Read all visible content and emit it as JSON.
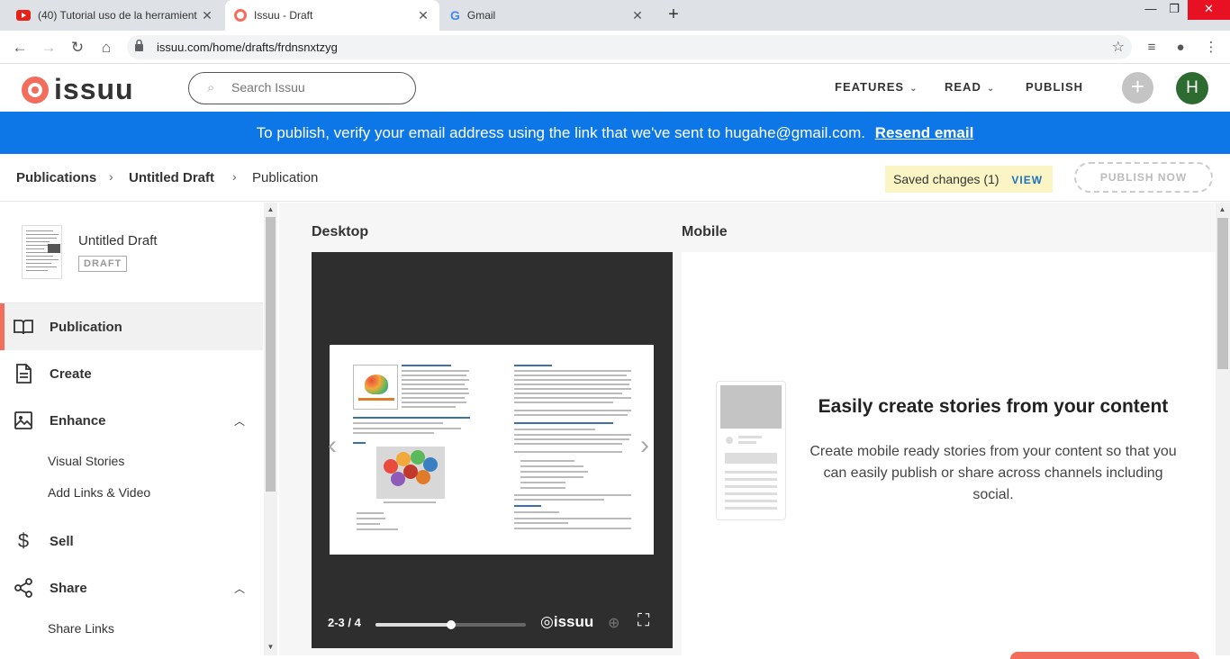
{
  "browser": {
    "tabs": [
      {
        "title": "(40) Tutorial uso de la herramient",
        "icon": "youtube-icon"
      },
      {
        "title": "Issuu - Draft",
        "icon": "issuu-icon"
      },
      {
        "title": "Gmail",
        "icon": "google-icon"
      }
    ],
    "new_tab": "+",
    "url": "issuu.com/home/drafts/frdnsnxtzyg"
  },
  "header": {
    "logo": "issuu",
    "search_placeholder": "Search Issuu",
    "nav": {
      "features": "FEATURES",
      "read": "READ",
      "publish": "PUBLISH"
    },
    "avatar_initial": "H"
  },
  "banner": {
    "text": "To publish, verify your email address using the link that we've sent to hugahe@gmail.com.",
    "link": "Resend email"
  },
  "breadcrumb": {
    "items": [
      "Publications",
      "Untitled Draft",
      "Publication"
    ]
  },
  "status": {
    "saved": "Saved changes (1)",
    "view": "VIEW",
    "publish_now": "PUBLISH NOW"
  },
  "sidebar": {
    "draft_title": "Untitled Draft",
    "draft_badge": "DRAFT",
    "items": [
      {
        "label": "Publication",
        "icon": "book-icon"
      },
      {
        "label": "Create",
        "icon": "document-icon"
      },
      {
        "label": "Enhance",
        "icon": "image-icon"
      },
      {
        "label": "Sell",
        "icon": "dollar-icon"
      },
      {
        "label": "Share",
        "icon": "share-icon"
      }
    ],
    "enhance_sub": [
      "Visual Stories",
      "Add Links & Video"
    ],
    "share_sub": [
      "Share Links"
    ]
  },
  "main": {
    "desktop_label": "Desktop",
    "mobile_label": "Mobile",
    "viewer": {
      "page": "2-3 / 4",
      "brand": "issuu",
      "progress": 0.5
    },
    "stories": {
      "title": "Easily create stories from your content",
      "description": "Create mobile ready stories from your content so that you can easily publish or share across channels including social."
    }
  },
  "colors": {
    "brand": "#f36d5d",
    "banner": "#0e77e8",
    "avatar": "#2e6b30",
    "saved_bg": "#fbf5c6",
    "link": "#1d6fbf"
  }
}
